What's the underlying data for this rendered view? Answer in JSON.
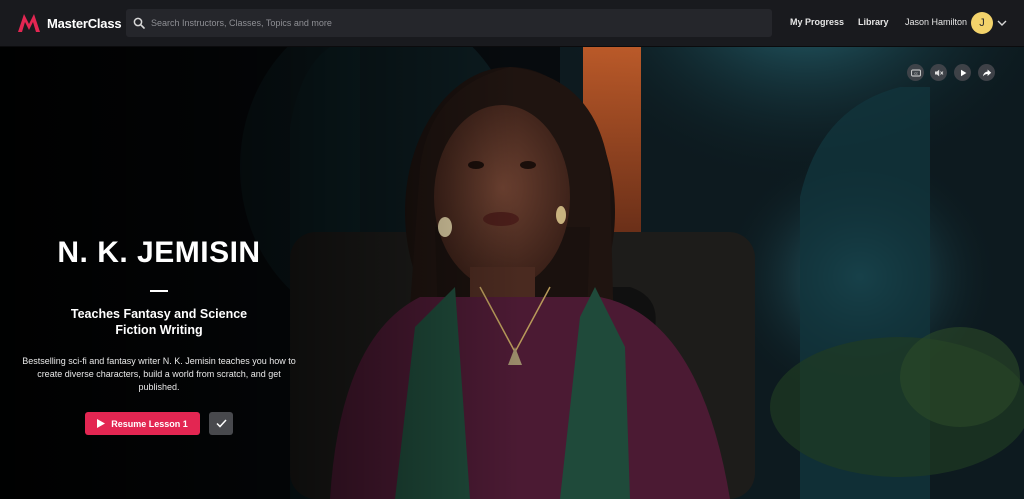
{
  "header": {
    "brand_name": "MasterClass",
    "search_placeholder": "Search Instructors, Classes, Topics and more",
    "my_progress": "My Progress",
    "library": "Library",
    "user_name": "Jason Hamilton",
    "avatar_initial": "J"
  },
  "hero": {
    "instructor_name": "N. K. JEMISIN",
    "course_title": "Teaches Fantasy and Science Fiction Writing",
    "description": "Bestselling sci-fi and fantasy writer N. K. Jemisin teaches you how to create diverse characters, build a world from scratch, and get published.",
    "resume_label": "Resume Lesson 1",
    "controls": {
      "captions_icon": "captions-icon",
      "mute_icon": "volume-muted-icon",
      "play_icon": "play-icon",
      "share_icon": "share-icon"
    }
  },
  "colors": {
    "accent": "#e32652",
    "topbar": "#191a1e",
    "search_bg": "#25262b",
    "avatar": "#f3d36b"
  }
}
